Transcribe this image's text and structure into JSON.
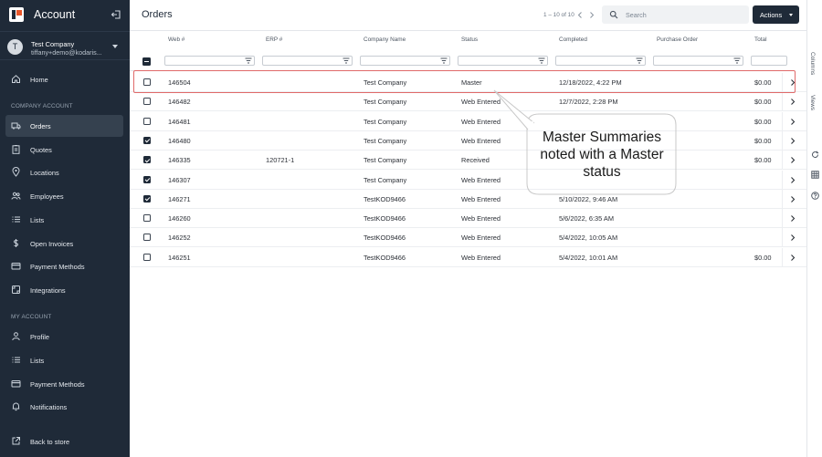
{
  "brand": {
    "title": "Account"
  },
  "account": {
    "avatar_initial": "T",
    "name": "Test Company",
    "email": "tiffany+demo@kodaris..."
  },
  "sidebar": {
    "items": [
      {
        "label": "Home",
        "icon": "home-icon"
      }
    ],
    "company_section": "COMPANY ACCOUNT",
    "company_items": [
      {
        "label": "Orders",
        "icon": "truck-icon",
        "active": true
      },
      {
        "label": "Quotes",
        "icon": "clipboard-icon"
      },
      {
        "label": "Locations",
        "icon": "pin-icon"
      },
      {
        "label": "Employees",
        "icon": "people-icon"
      },
      {
        "label": "Lists",
        "icon": "list-icon"
      },
      {
        "label": "Open Invoices",
        "icon": "dollar-icon"
      },
      {
        "label": "Payment Methods",
        "icon": "card-icon"
      },
      {
        "label": "Integrations",
        "icon": "integration-icon"
      }
    ],
    "my_section": "MY ACCOUNT",
    "my_items": [
      {
        "label": "Profile",
        "icon": "person-icon"
      },
      {
        "label": "Lists",
        "icon": "list-icon"
      },
      {
        "label": "Payment Methods",
        "icon": "card-icon"
      },
      {
        "label": "Notifications",
        "icon": "bell-icon"
      }
    ],
    "back_label": "Back to store"
  },
  "header": {
    "title": "Orders",
    "pager_text": "1 – 10 of 10",
    "search_placeholder": "Search",
    "actions_label": "Actions"
  },
  "table": {
    "columns": [
      "Web #",
      "ERP #",
      "Company Name",
      "Status",
      "Completed",
      "Purchase Order",
      "Total"
    ],
    "rows": [
      {
        "checked": false,
        "web": "146504",
        "erp": "",
        "company": "Test Company",
        "status": "Master",
        "completed": "12/18/2022, 4:22 PM",
        "po": "",
        "total": "$0.00"
      },
      {
        "checked": false,
        "web": "146482",
        "erp": "",
        "company": "Test Company",
        "status": "Web Entered",
        "completed": "12/7/2022, 2:28 PM",
        "po": "",
        "total": "$0.00"
      },
      {
        "checked": false,
        "web": "146481",
        "erp": "",
        "company": "Test Company",
        "status": "Web Entered",
        "completed": "",
        "po": "",
        "total": "$0.00"
      },
      {
        "checked": true,
        "web": "146480",
        "erp": "",
        "company": "Test Company",
        "status": "Web Entered",
        "completed": "",
        "po": "",
        "total": "$0.00"
      },
      {
        "checked": true,
        "web": "146335",
        "erp": "120721-1",
        "company": "Test Company",
        "status": "Received",
        "completed": "",
        "po": "",
        "total": "$0.00"
      },
      {
        "checked": true,
        "web": "146307",
        "erp": "",
        "company": "Test Company",
        "status": "Web Entered",
        "completed": "",
        "po": "",
        "total": ""
      },
      {
        "checked": true,
        "web": "146271",
        "erp": "",
        "company": "TestKOD9466",
        "status": "Web Entered",
        "completed": "5/10/2022, 9:46 AM",
        "po": "",
        "total": ""
      },
      {
        "checked": false,
        "web": "146260",
        "erp": "",
        "company": "TestKOD9466",
        "status": "Web Entered",
        "completed": "5/6/2022, 6:35 AM",
        "po": "",
        "total": ""
      },
      {
        "checked": false,
        "web": "146252",
        "erp": "",
        "company": "TestKOD9466",
        "status": "Web Entered",
        "completed": "5/4/2022, 10:05 AM",
        "po": "",
        "total": ""
      },
      {
        "checked": false,
        "web": "146251",
        "erp": "",
        "company": "TestKOD9466",
        "status": "Web Entered",
        "completed": "5/4/2022, 10:01 AM",
        "po": "",
        "total": "$0.00"
      }
    ]
  },
  "callout": {
    "text": "Master Summaries noted with a Master status"
  },
  "rail": {
    "columns_label": "Columns",
    "views_label": "Views"
  }
}
